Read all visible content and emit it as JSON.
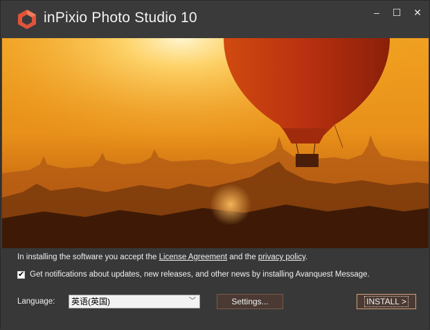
{
  "app": {
    "title": "inPixio Photo Studio 10",
    "logo_icon": "inpixio-cube-logo-icon",
    "brand_color": "#e0533a"
  },
  "window_controls": {
    "minimize": "–",
    "maximize": "☐",
    "close": "✕"
  },
  "notice": {
    "prefix": "In installing the software you accept the ",
    "license_link": "License Agreement",
    "middle": " and the ",
    "privacy_link": "privacy policy",
    "suffix": "."
  },
  "notifications": {
    "checked": true,
    "label": "Get notifications about updates, new releases, and other news by installing Avanquest Message."
  },
  "language": {
    "label": "Language:",
    "selected": "英语(英国)"
  },
  "buttons": {
    "settings": "Settings...",
    "install": "INSTALL >"
  }
}
